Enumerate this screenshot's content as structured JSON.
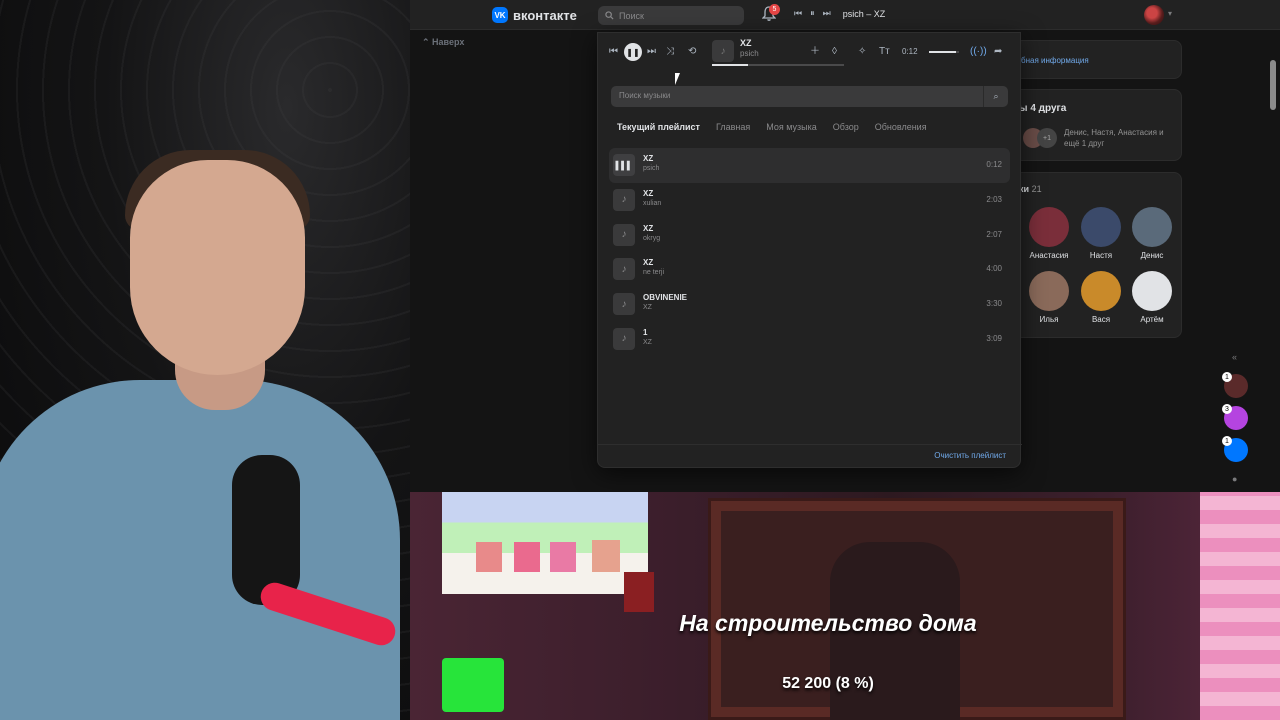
{
  "vk": {
    "brand": "вконтакте",
    "search_placeholder": "Поиск",
    "notifications_count": "5",
    "mini_player_track": "psich – XZ",
    "up_link": "Наверх"
  },
  "right_column": {
    "info_link": "бная информация",
    "mutual_title": "ы 4 друга",
    "mutual_plus": "+1",
    "mutual_names": "Денис, Настя, Анастасия и ещё 1 друг",
    "friends_title": "ки",
    "friends_count": "21",
    "friends": [
      {
        "name": "Анастасия",
        "color": "#7a2e3a"
      },
      {
        "name": "Настя",
        "color": "#3b4a6a"
      },
      {
        "name": "Денис",
        "color": "#5a6a7a"
      },
      {
        "name": "Илья",
        "color": "#8a6a5a"
      },
      {
        "name": "Вася",
        "color": "#c98a2a"
      },
      {
        "name": "Артём",
        "color": "#e1e3e6"
      }
    ],
    "side_badges": [
      "1",
      "3",
      "1"
    ]
  },
  "music": {
    "current": {
      "title": "XZ",
      "artist": "psich",
      "time": "0:12",
      "progress": 0.27,
      "volume": 0.9
    },
    "search_placeholder": "Поиск музыки",
    "tabs": [
      "Текущий плейлист",
      "Главная",
      "Моя музыка",
      "Обзор",
      "Обновления"
    ],
    "tracks": [
      {
        "title": "XZ",
        "artist": "psich",
        "duration": "0:12"
      },
      {
        "title": "XZ",
        "artist": "xulian",
        "duration": "2:03"
      },
      {
        "title": "XZ",
        "artist": "okryg",
        "duration": "2:07"
      },
      {
        "title": "XZ",
        "artist": "ne terji",
        "duration": "4:00"
      },
      {
        "title": "OBVINENIE",
        "artist": "XZ",
        "duration": "3:30"
      },
      {
        "title": "1",
        "artist": "XZ",
        "duration": "3:09"
      }
    ],
    "clear_label": "Очистить плейлист"
  },
  "stream": {
    "goal_title": "На строительство дома",
    "goal_value": "52 200 (8 %)",
    "goal_progress": 0.08,
    "goal_color": "#27e43a"
  }
}
